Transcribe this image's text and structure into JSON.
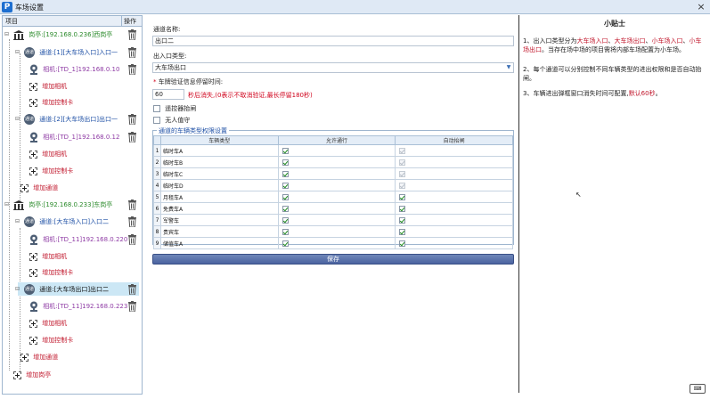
{
  "window": {
    "title": "车场设置",
    "logo": "P",
    "close": "×"
  },
  "tree": {
    "header": {
      "item": "项目",
      "op": "操作"
    },
    "booth1": {
      "label": "岗亭:[192.168.0.236]西岗亭"
    },
    "ch1": {
      "label": "通道:[1][大车场入口]入口一",
      "icon": "通道"
    },
    "cam1": {
      "label": "相机:[TD_1]192.168.0.10"
    },
    "addcam1": "增加相机",
    "addcard1": "增加控制卡",
    "ch2": {
      "label": "通道:[2][大车场出口]出口一",
      "icon": "通道"
    },
    "cam2": {
      "label": "相机:[TD_1]192.168.0.12"
    },
    "addcam2": "增加相机",
    "addcard2": "增加控制卡",
    "addch1": "增加通道",
    "booth2": {
      "label": "岗亭:[192.168.0.233]东岗亭"
    },
    "ch3": {
      "label": "通道:[大车场入口]入口二",
      "icon": "通道"
    },
    "cam3": {
      "label": "相机:[TD_11]192.168.0.220"
    },
    "addcam3": "增加相机",
    "addcard3": "增加控制卡",
    "ch4": {
      "label": "通道:[大车场出口]出口二",
      "icon": "通道"
    },
    "cam4": {
      "label": "相机:[TD_11]192.168.0.223"
    },
    "addcam4": "增加相机",
    "addcard4": "增加控制卡",
    "addch2": "增加通道",
    "addbooth": "增加岗亭"
  },
  "form": {
    "name_label": "通道名称:",
    "name_value": "出口二",
    "type_label": "出入口类型:",
    "type_value": "大车场出口",
    "timeout_label": "车牌验证信息停留时间:",
    "timeout_value": "60",
    "timeout_hint": "秒后消失,(0表示不取消验证,最长停留180秒)",
    "remote_label": "遥控器抬闸",
    "unattended_label": "无人值守",
    "group_title": "通道的车辆类型权限设置",
    "columns": [
      "车辆类型",
      "允许通行",
      "自动抬闸"
    ],
    "rows": [
      {
        "n": "1",
        "type": "临时车A",
        "allow": true,
        "auto": false
      },
      {
        "n": "2",
        "type": "临时车B",
        "allow": true,
        "auto": false
      },
      {
        "n": "3",
        "type": "临时车C",
        "allow": true,
        "auto": false
      },
      {
        "n": "4",
        "type": "临时车D",
        "allow": true,
        "auto": false
      },
      {
        "n": "5",
        "type": "月租车A",
        "allow": true,
        "auto": true
      },
      {
        "n": "6",
        "type": "免费车A",
        "allow": true,
        "auto": true
      },
      {
        "n": "7",
        "type": "军警车",
        "allow": true,
        "auto": true
      },
      {
        "n": "8",
        "type": "贵宾车",
        "allow": true,
        "auto": true
      },
      {
        "n": "9",
        "type": "储值车A",
        "allow": true,
        "auto": true
      }
    ],
    "save_label": "保存"
  },
  "tips": {
    "title": "小贴士",
    "t1_a": "1、出入口类型分为",
    "t1_red1": "大车场入口",
    "t1_sep1": "、",
    "t1_red2": "大车场出口",
    "t1_sep2": "、",
    "t1_red3": "小车场入口",
    "t1_sep3": "、",
    "t1_red4": "小车场出口",
    "t1_b": "。当存在场中场的项目需将内部车场配置为小车场。",
    "t2": "2、每个通道可以分别控制不同车辆类型的进出权限和是否自动抬闸。",
    "t3_a": "3、车辆进出弹框窗口消失时间可配置,",
    "t3_red": "默认60秒",
    "t3_b": "。",
    "keyboard": "⌨"
  },
  "colors": {
    "accent": "#1e6fd0",
    "green": "#2a8a2a",
    "purple": "#8f3ca5",
    "red": "#c0152a"
  }
}
